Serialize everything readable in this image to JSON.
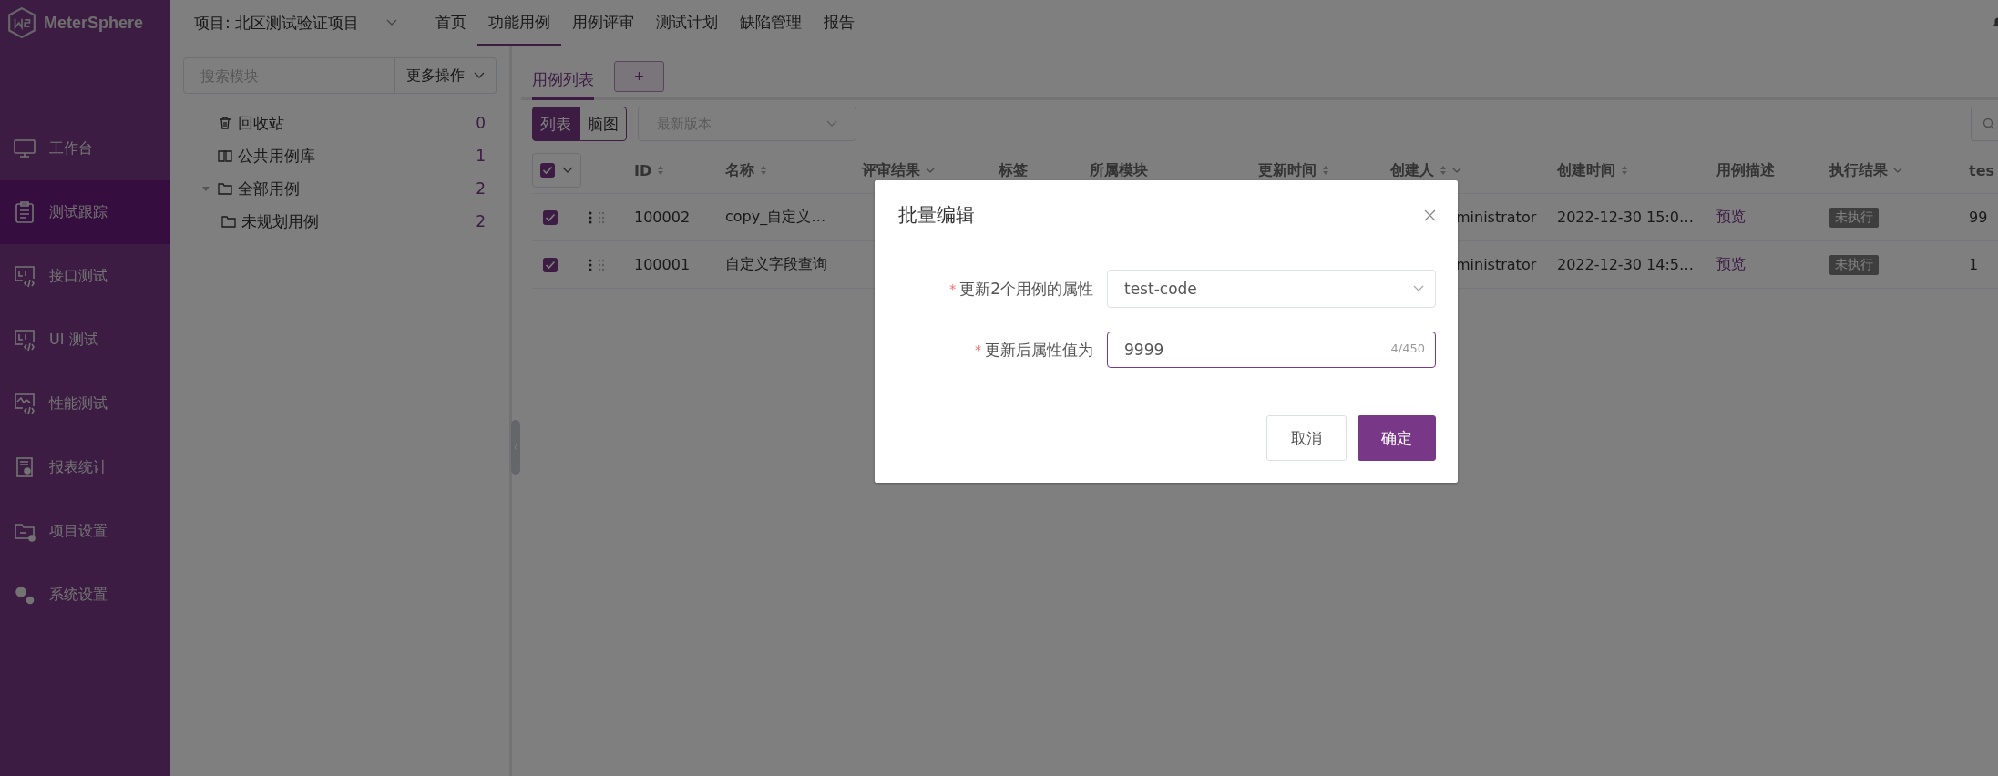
{
  "app": {
    "name": "MeterSphere"
  },
  "sidebar": {
    "items": [
      {
        "label": "工作台",
        "selected": false
      },
      {
        "label": "测试跟踪",
        "selected": true
      },
      {
        "label": "接口测试",
        "selected": false
      },
      {
        "label": "UI 测试",
        "selected": false
      },
      {
        "label": "性能测试",
        "selected": false
      },
      {
        "label": "报表统计",
        "selected": false
      },
      {
        "label": "项目设置",
        "selected": false
      },
      {
        "label": "系统设置",
        "selected": false
      }
    ]
  },
  "topbar": {
    "project": "项目: 北区测试验证项目",
    "tabs": [
      {
        "label": "首页",
        "selected": false
      },
      {
        "label": "功能用例",
        "selected": true
      },
      {
        "label": "用例评审",
        "selected": false
      },
      {
        "label": "测试计划",
        "selected": false
      },
      {
        "label": "缺陷管理",
        "selected": false
      },
      {
        "label": "报告",
        "selected": false
      }
    ]
  },
  "module_tree": {
    "search_placeholder": "搜索模块",
    "more_actions": "更多操作",
    "items": [
      {
        "label": "回收站",
        "count": "0"
      },
      {
        "label": "公共用例库",
        "count": "1"
      },
      {
        "label": "全部用例",
        "count": "2",
        "expanded": true,
        "children": [
          {
            "label": "未规划用例",
            "count": "2"
          }
        ]
      }
    ]
  },
  "case_tabs": [
    {
      "label": "用例列表",
      "selected": true
    }
  ],
  "add_tab": "+",
  "view_toggle": [
    {
      "label": "列表",
      "selected": true
    },
    {
      "label": "脑图",
      "selected": false
    }
  ],
  "version_select": {
    "placeholder": "最新版本"
  },
  "table": {
    "header_checked": true,
    "columns": [
      {
        "label": "ID",
        "sort": true,
        "filter": false
      },
      {
        "label": "名称",
        "sort": true,
        "filter": false
      },
      {
        "label": "评审结果",
        "sort": false,
        "filter": true
      },
      {
        "label": "标签",
        "sort": false,
        "filter": false
      },
      {
        "label": "所属模块",
        "sort": false,
        "filter": false
      },
      {
        "label": "更新时间",
        "sort": true,
        "filter": false
      },
      {
        "label": "创建人",
        "sort": true,
        "filter": true
      },
      {
        "label": "创建时间",
        "sort": true,
        "filter": false
      },
      {
        "label": "用例描述",
        "sort": false,
        "filter": false
      },
      {
        "label": "执行结果",
        "sort": false,
        "filter": true
      },
      {
        "label": "tes",
        "sort": false,
        "filter": false
      }
    ],
    "rows": [
      {
        "checked": true,
        "id": "100002",
        "name": "copy_自定义…",
        "creator": "ministrator",
        "created": "2022-12-30 15:0…",
        "description": "预览",
        "result": "未执行",
        "column_tes": "99"
      },
      {
        "checked": true,
        "id": "100001",
        "name": "自定义字段查询",
        "creator": "ministrator",
        "created": "2022-12-30 14:5…",
        "description": "预览",
        "result": "未执行",
        "column_tes": "1"
      }
    ]
  },
  "dialog": {
    "title": "批量编辑",
    "fields": [
      {
        "kind": "select",
        "required_mark": "*",
        "label": "更新2个用例的属性",
        "value": "test-code"
      },
      {
        "kind": "input",
        "required_mark": "*",
        "label": "更新后属性值为",
        "value": "9999",
        "counter": "4/450"
      }
    ],
    "buttons": [
      {
        "label": "取消",
        "kind": "secondary"
      },
      {
        "label": "确定",
        "kind": "primary"
      }
    ]
  }
}
